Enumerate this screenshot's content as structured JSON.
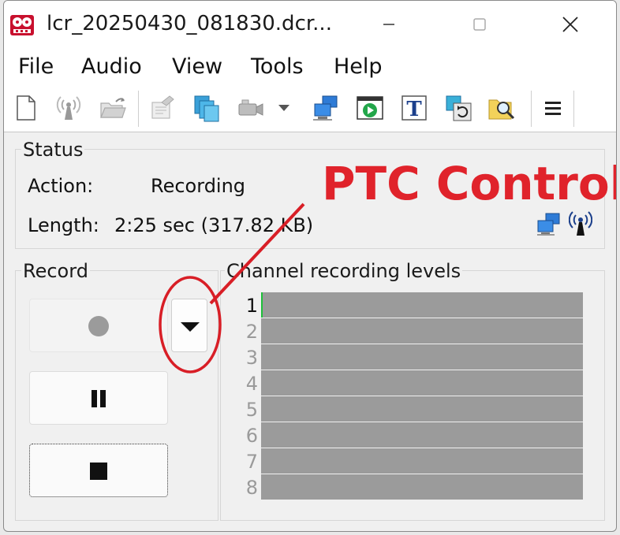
{
  "window": {
    "title": "lcr_20250430_081830.dcr..."
  },
  "menu": [
    "File",
    "Audio",
    "View",
    "Tools",
    "Help"
  ],
  "toolbar": {
    "icons": [
      "new-file-icon",
      "antenna-icon",
      "open-folder-icon",
      "record-settings-icon",
      "copy-files-icon",
      "camera-icon",
      "dropdown-icon",
      "network-icon",
      "play-icon",
      "text-icon",
      "undo-icon",
      "search-icon",
      "menu-icon"
    ]
  },
  "status": {
    "title": "Status",
    "action_label": "Action:",
    "action_value": "Recording",
    "length_label": "Length:",
    "length_value": "2:25 sec (317.82 KB)"
  },
  "record": {
    "title": "Record"
  },
  "channels": {
    "title": "Channel recording levels",
    "numbers": [
      "1",
      "2",
      "3",
      "4",
      "5",
      "6",
      "7",
      "8"
    ],
    "active": "1"
  },
  "annotation": {
    "text": "PTC Control",
    "color": "#e0232b"
  }
}
